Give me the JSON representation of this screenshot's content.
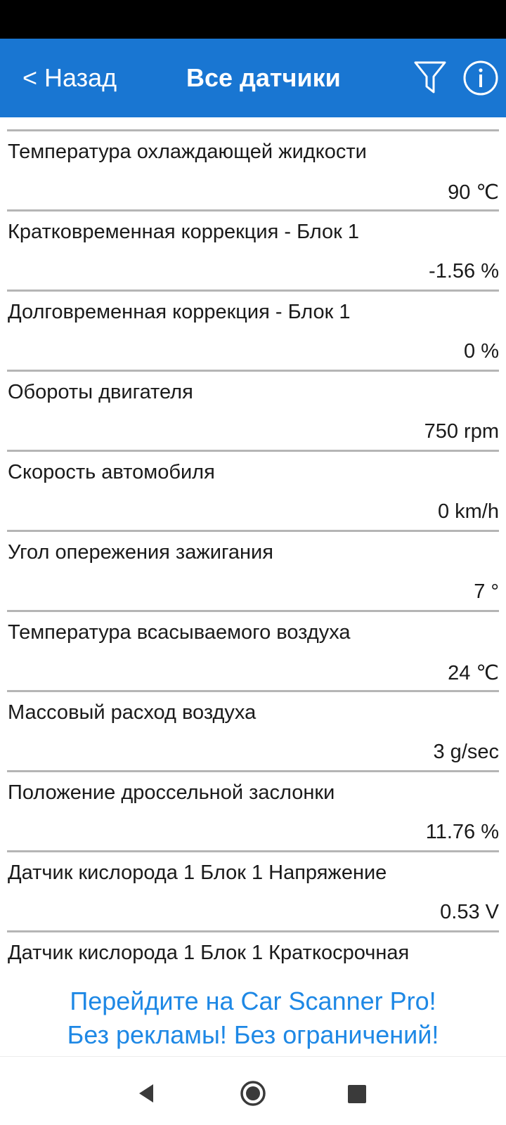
{
  "header": {
    "back_label": "< Назад",
    "title": "Все датчики",
    "icons": [
      "filter-icon",
      "info-icon"
    ],
    "background_color": "#1976d2"
  },
  "sensors": [
    {
      "name": "Температура охлаждающей жидкости",
      "value": "90 ℃"
    },
    {
      "name": "Кратковременная коррекция - Блок 1",
      "value": "-1.56 %"
    },
    {
      "name": "Долговременная коррекция - Блок 1",
      "value": "0 %"
    },
    {
      "name": "Обороты двигателя",
      "value": "750 rpm"
    },
    {
      "name": "Скорость автомобиля",
      "value": "0 km/h"
    },
    {
      "name": "Угол опережения зажигания",
      "value": "7 °"
    },
    {
      "name": "Температура всасываемого воздуха",
      "value": "24 ℃"
    },
    {
      "name": "Массовый расход воздуха",
      "value": "3 g/sec"
    },
    {
      "name": "Положение дроссельной заслонки",
      "value": "11.76 %"
    },
    {
      "name": "Датчик кислорода 1 Блок 1 Напряжение",
      "value": "0.53 V"
    },
    {
      "name": "Датчик кислорода 1 Блок 1 Краткосрочная",
      "value": ""
    }
  ],
  "promo": {
    "line1": "Перейдите на Car Scanner Pro!",
    "line2": "Без рекламы! Без ограничений!",
    "color": "#1e88e5"
  },
  "nav": {
    "icons": [
      "back-triangle-icon",
      "home-circle-icon",
      "recents-square-icon"
    ]
  }
}
